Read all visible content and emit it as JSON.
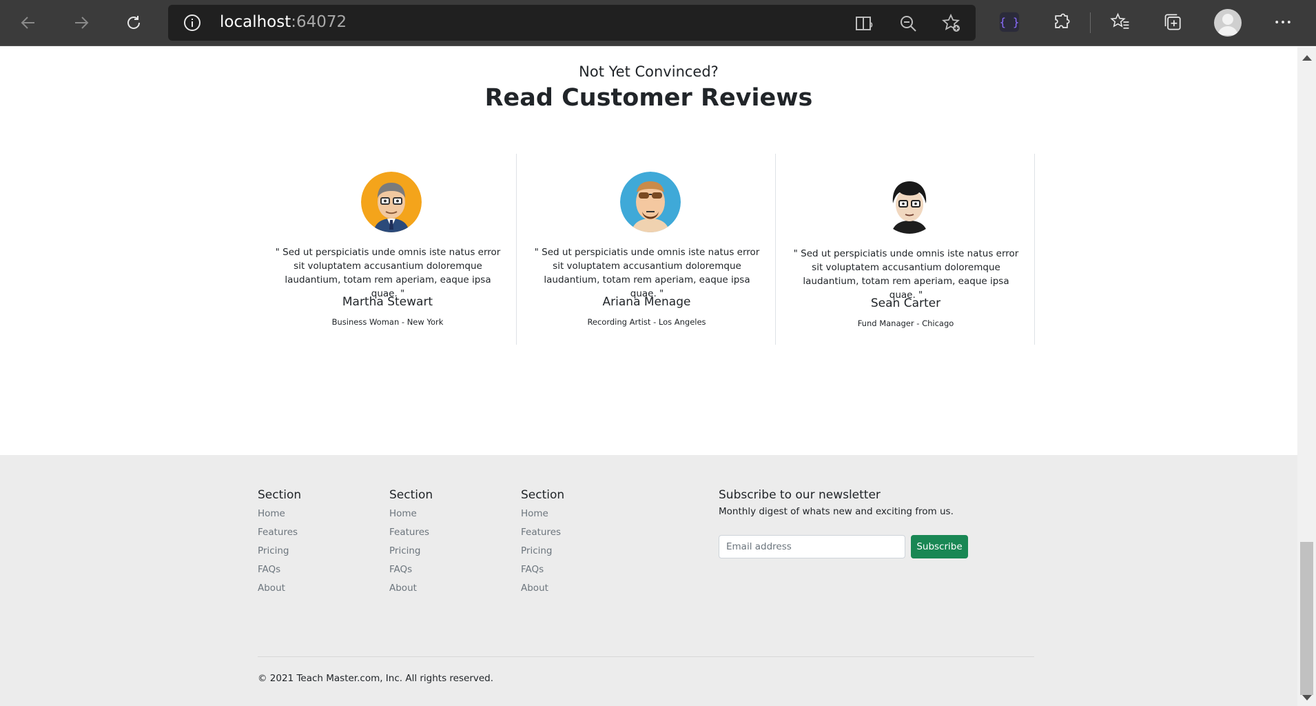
{
  "browser": {
    "url_host": "localhost",
    "url_port": ":64072",
    "icons": [
      "back-icon",
      "forward-icon",
      "refresh-icon",
      "info-icon",
      "immersive-reader-icon",
      "zoom-out-icon",
      "add-favorite-icon",
      "devtools-extension-icon",
      "extensions-icon",
      "favorites-icon",
      "collections-icon",
      "profile-icon",
      "more-icon"
    ]
  },
  "reviews": {
    "kicker": "Not Yet Convinced?",
    "title": "Read Customer Reviews",
    "items": [
      {
        "quote": "\" Sed ut perspiciatis unde omnis iste natus error sit voluptatem accusantium doloremque laudantium, totam rem aperiam, eaque ipsa quae. \"",
        "name": "Martha Stewart",
        "role": "Business Woman - New York"
      },
      {
        "quote": "\" Sed ut perspiciatis unde omnis iste natus error sit voluptatem accusantium doloremque laudantium, totam rem aperiam, eaque ipsa quae. \"",
        "name": "Ariana Menage",
        "role": "Recording Artist - Los Angeles"
      },
      {
        "quote": "\" Sed ut perspiciatis unde omnis iste natus error sit voluptatem accusantium doloremque laudantium, totam rem aperiam, eaque ipsa quae. \"",
        "name": "Sean Carter",
        "role": "Fund Manager - Chicago"
      }
    ]
  },
  "footer": {
    "columns": [
      {
        "title": "Section",
        "links": [
          "Home",
          "Features",
          "Pricing",
          "FAQs",
          "About"
        ]
      },
      {
        "title": "Section",
        "links": [
          "Home",
          "Features",
          "Pricing",
          "FAQs",
          "About"
        ]
      },
      {
        "title": "Section",
        "links": [
          "Home",
          "Features",
          "Pricing",
          "FAQs",
          "About"
        ]
      }
    ],
    "newsletter": {
      "title": "Subscribe to our newsletter",
      "text": "Monthly digest of whats new and exciting from us.",
      "placeholder": "Email address",
      "button": "Subscribe"
    },
    "copyright": "© 2021 Teach Master.com, Inc. All rights reserved."
  },
  "colors": {
    "chrome_bg": "#3b3b3b",
    "subscribe_green": "#198754",
    "footer_bg": "#ececec"
  }
}
